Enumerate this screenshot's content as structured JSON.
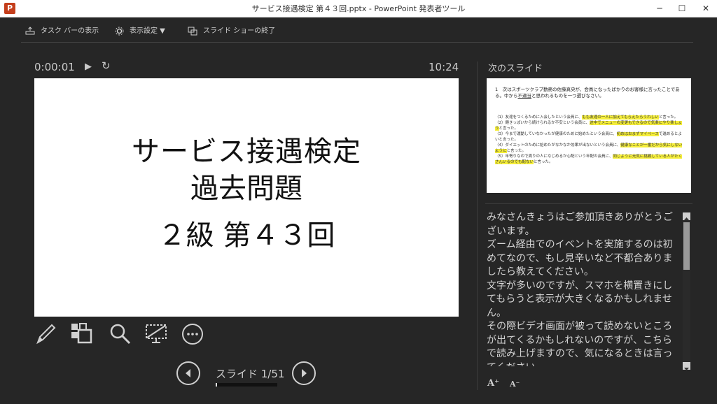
{
  "window": {
    "title": "サービス接遇検定 第４３回.pptx - PowerPoint 発表者ツール",
    "app_icon": "P",
    "minimize_glyph": "─",
    "maximize_glyph": "☐",
    "close_glyph": "✕"
  },
  "toolbar": {
    "taskbar_label": "タスク バーの表示",
    "display_settings_label": "表示設定 ▼",
    "end_show_label": "スライド ショーの終了"
  },
  "timer": {
    "elapsed": "0:00:01",
    "clock": "10:24",
    "play_glyph": "▶",
    "reset_glyph": "↻"
  },
  "current_slide": {
    "line1": "サービス接遇検定",
    "line2": "過去問題",
    "line3": "２級 第４３回"
  },
  "navigation": {
    "counter": "スライド 1/51",
    "progress": 0.0196
  },
  "next_slide": {
    "label": "次のスライド",
    "question_pre": "1　次はスポーツクラブ勤務の佐藤真央が、会員になったばかりのお客様に言ったことである。中から",
    "question_ul": "不適当",
    "question_post": "と思われるものを一つ選びなさい。",
    "options": [
      {
        "text": "（1）友達をつくるために入会したという会員に、",
        "hl": "もも友達の一人に加えてもらえたらうれしい",
        "rest": "と言った。"
      },
      {
        "text": "（2）飽きっぽいから続けられるか不安という会員に、",
        "hl": "途中でメニューの変更もできるので気楽にやり楽しょう",
        "rest": "と言った。"
      },
      {
        "text": "（3）今まで運動していなかったが健康のために始めたという会員に、",
        "hl": "初めはおまずマイペース",
        "rest": "で進めるとよいと言った。"
      },
      {
        "text": "（4）ダイエットのために始めたがなかなか効果が出ないという会員に、",
        "hl": "健康なことが一番だから気にしないように",
        "rest": "と言った。"
      },
      {
        "text": "（5）年寄りなので周りの人になじめるか心配という年配の会員に、",
        "hl": "同じように元気に挑戦している人がたくさんいるのでも配ない",
        "rest": "と言った。"
      }
    ]
  },
  "notes": [
    "みなさんきょうはご参加頂きありがとうございます。",
    "ズーム経由でのイベントを実施するのは初めてなので、もし見辛いなど不都合ありましたら教えてください。",
    "文字が多いのですが、スマホを横置きにしてもらうと表示が大きくなるかもしれません。",
    "その際ビデオ画面が被って読めないところが出てくるかもしれないのですが、こちらで読み上げますので、気になるときは言ってください。"
  ],
  "font_controls": {
    "increase_glyph": "A⁺",
    "decrease_glyph": "A⁻"
  },
  "colors": {
    "background": "#262626",
    "highlight": "#f5ee3a",
    "app_accent": "#c43e1c"
  }
}
